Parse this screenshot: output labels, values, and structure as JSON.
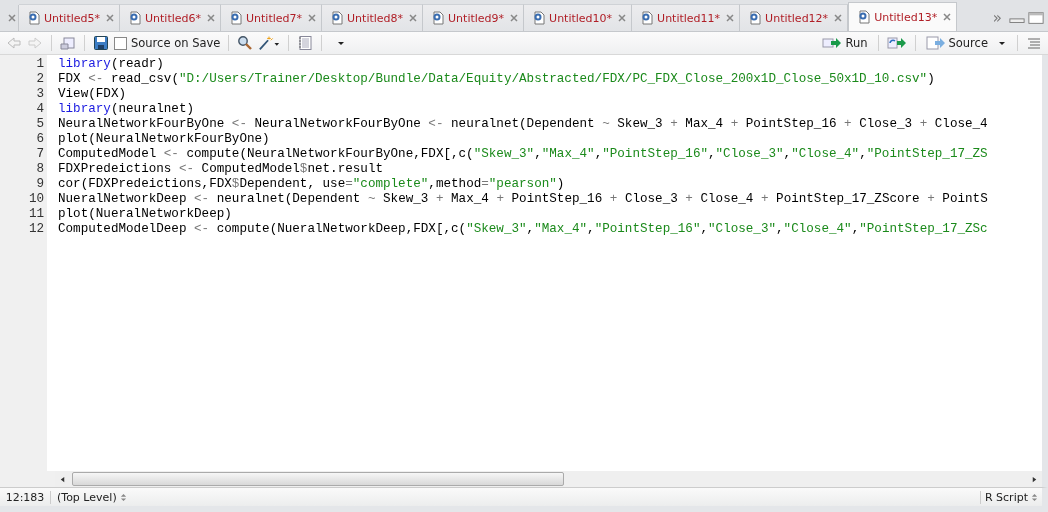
{
  "tabs": [
    {
      "label": "Untitled5*",
      "selected": false
    },
    {
      "label": "Untitled6*",
      "selected": false
    },
    {
      "label": "Untitled7*",
      "selected": false
    },
    {
      "label": "Untitled8*",
      "selected": false
    },
    {
      "label": "Untitled9*",
      "selected": false
    },
    {
      "label": "Untitled10*",
      "selected": false
    },
    {
      "label": "Untitled11*",
      "selected": false
    },
    {
      "label": "Untitled12*",
      "selected": false
    },
    {
      "label": "Untitled13*",
      "selected": true
    }
  ],
  "overflow_label": "»",
  "toolbar": {
    "source_on_save": {
      "label": "Source on Save",
      "checked": false
    },
    "run_label": "Run",
    "source_label": "Source"
  },
  "editor": {
    "lines": [
      {
        "number": "1",
        "tokens": [
          {
            "kind": "keyword",
            "text": "library"
          },
          {
            "kind": "plain",
            "text": "(readr)"
          }
        ]
      },
      {
        "number": "2",
        "tokens": [
          {
            "kind": "plain",
            "text": "FDX "
          },
          {
            "kind": "op",
            "text": "<-"
          },
          {
            "kind": "plain",
            "text": " read_csv("
          },
          {
            "kind": "string",
            "text": "\"D:/Users/Trainer/Desktop/Bundle/Data/Equity/Abstracted/FDX/PC_FDX_Close_200x1D_Close_50x1D_10.csv\""
          },
          {
            "kind": "plain",
            "text": ")"
          }
        ]
      },
      {
        "number": "3",
        "tokens": [
          {
            "kind": "plain",
            "text": "View(FDX)"
          }
        ]
      },
      {
        "number": "4",
        "tokens": [
          {
            "kind": "keyword",
            "text": "library"
          },
          {
            "kind": "plain",
            "text": "(neuralnet)"
          }
        ]
      },
      {
        "number": "5",
        "tokens": [
          {
            "kind": "plain",
            "text": "NeuralNetworkFourByOne "
          },
          {
            "kind": "op",
            "text": "<-"
          },
          {
            "kind": "plain",
            "text": " NeuralNetworkFourByOne "
          },
          {
            "kind": "op",
            "text": "<-"
          },
          {
            "kind": "plain",
            "text": " neuralnet(Dependent "
          },
          {
            "kind": "op",
            "text": "~"
          },
          {
            "kind": "plain",
            "text": " Skew_3 "
          },
          {
            "kind": "op",
            "text": "+"
          },
          {
            "kind": "plain",
            "text": " Max_4 "
          },
          {
            "kind": "op",
            "text": "+"
          },
          {
            "kind": "plain",
            "text": " PointStep_16 "
          },
          {
            "kind": "op",
            "text": "+"
          },
          {
            "kind": "plain",
            "text": " Close_3 "
          },
          {
            "kind": "op",
            "text": "+"
          },
          {
            "kind": "plain",
            "text": " Close_4"
          }
        ]
      },
      {
        "number": "6",
        "tokens": [
          {
            "kind": "plain",
            "text": "plot(NeuralNetworkFourByOne)"
          }
        ]
      },
      {
        "number": "7",
        "tokens": [
          {
            "kind": "plain",
            "text": "ComputedModel "
          },
          {
            "kind": "op",
            "text": "<-"
          },
          {
            "kind": "plain",
            "text": " compute(NeuralNetworkFourByOne,FDX[,c("
          },
          {
            "kind": "string",
            "text": "\"Skew_3\""
          },
          {
            "kind": "plain",
            "text": ","
          },
          {
            "kind": "string",
            "text": "\"Max_4\""
          },
          {
            "kind": "plain",
            "text": ","
          },
          {
            "kind": "string",
            "text": "\"PointStep_16\""
          },
          {
            "kind": "plain",
            "text": ","
          },
          {
            "kind": "string",
            "text": "\"Close_3\""
          },
          {
            "kind": "plain",
            "text": ","
          },
          {
            "kind": "string",
            "text": "\"Close_4\""
          },
          {
            "kind": "plain",
            "text": ","
          },
          {
            "kind": "string",
            "text": "\"PointStep_17_ZS"
          }
        ]
      },
      {
        "number": "8",
        "tokens": [
          {
            "kind": "plain",
            "text": "FDXPredeictions "
          },
          {
            "kind": "op",
            "text": "<-"
          },
          {
            "kind": "plain",
            "text": " ComputedModel"
          },
          {
            "kind": "op",
            "text": "$"
          },
          {
            "kind": "plain",
            "text": "net.result"
          }
        ]
      },
      {
        "number": "9",
        "tokens": [
          {
            "kind": "plain",
            "text": "cor(FDXPredeictions,FDX"
          },
          {
            "kind": "op",
            "text": "$"
          },
          {
            "kind": "plain",
            "text": "Dependent, use"
          },
          {
            "kind": "op",
            "text": "="
          },
          {
            "kind": "string",
            "text": "\"complete\""
          },
          {
            "kind": "plain",
            "text": ",method"
          },
          {
            "kind": "op",
            "text": "="
          },
          {
            "kind": "string",
            "text": "\"pearson\""
          },
          {
            "kind": "plain",
            "text": ")"
          }
        ]
      },
      {
        "number": "10",
        "tokens": [
          {
            "kind": "plain",
            "text": "NueralNetworkDeep "
          },
          {
            "kind": "op",
            "text": "<-"
          },
          {
            "kind": "plain",
            "text": " neuralnet(Dependent "
          },
          {
            "kind": "op",
            "text": "~"
          },
          {
            "kind": "plain",
            "text": " Skew_3 "
          },
          {
            "kind": "op",
            "text": "+"
          },
          {
            "kind": "plain",
            "text": " Max_4 "
          },
          {
            "kind": "op",
            "text": "+"
          },
          {
            "kind": "plain",
            "text": " PointStep_16 "
          },
          {
            "kind": "op",
            "text": "+"
          },
          {
            "kind": "plain",
            "text": " Close_3 "
          },
          {
            "kind": "op",
            "text": "+"
          },
          {
            "kind": "plain",
            "text": " Close_4 "
          },
          {
            "kind": "op",
            "text": "+"
          },
          {
            "kind": "plain",
            "text": " PointStep_17_ZScore "
          },
          {
            "kind": "op",
            "text": "+"
          },
          {
            "kind": "plain",
            "text": " PointS"
          }
        ]
      },
      {
        "number": "11",
        "tokens": [
          {
            "kind": "plain",
            "text": "plot(NueralNetworkDeep)"
          }
        ]
      },
      {
        "number": "12",
        "tokens": [
          {
            "kind": "plain",
            "text": "ComputedModelDeep "
          },
          {
            "kind": "op",
            "text": "<-"
          },
          {
            "kind": "plain",
            "text": " compute(NueralNetworkDeep,FDX[,c("
          },
          {
            "kind": "string",
            "text": "\"Skew_3\""
          },
          {
            "kind": "plain",
            "text": ","
          },
          {
            "kind": "string",
            "text": "\"Max_4\""
          },
          {
            "kind": "plain",
            "text": ","
          },
          {
            "kind": "string",
            "text": "\"PointStep_16\""
          },
          {
            "kind": "plain",
            "text": ","
          },
          {
            "kind": "string",
            "text": "\"Close_3\""
          },
          {
            "kind": "plain",
            "text": ","
          },
          {
            "kind": "string",
            "text": "\"Close_4\""
          },
          {
            "kind": "plain",
            "text": ","
          },
          {
            "kind": "string",
            "text": "\"PointStep_17_ZSc"
          }
        ]
      }
    ]
  },
  "status_bar": {
    "position": "12:183",
    "scope": "(Top Level)",
    "file_type": "R Script"
  }
}
